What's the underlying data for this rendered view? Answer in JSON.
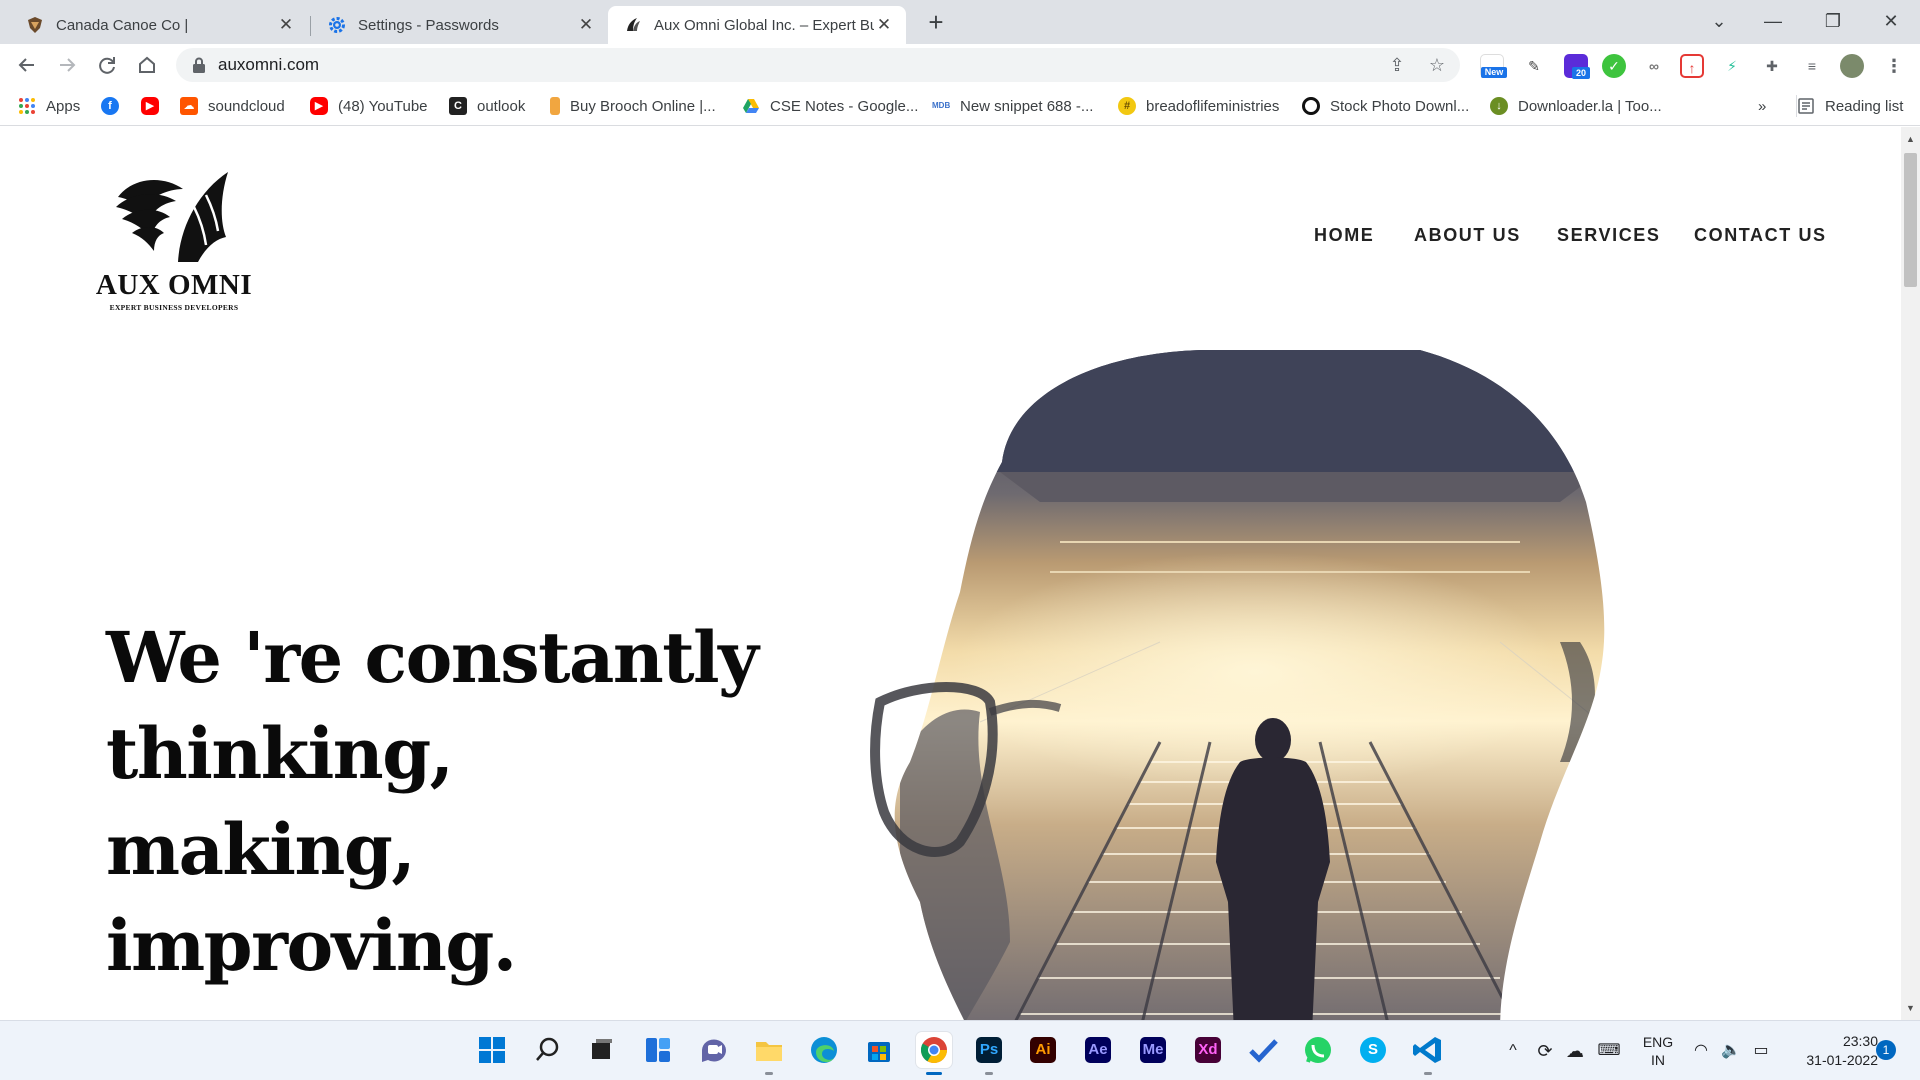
{
  "browser": {
    "tabs": [
      {
        "title": "Canada Canoe Co |",
        "favicon": "canoe-favicon",
        "active": false
      },
      {
        "title": "Settings - Passwords",
        "favicon": "gear-icon",
        "active": false
      },
      {
        "title": "Aux Omni Global Inc. – Expert Bu",
        "favicon": "aux-omni-favicon",
        "active": true
      }
    ],
    "close_glyph": "✕",
    "new_tab_glyph": "+",
    "window_controls": {
      "menu": "⌄",
      "minimize": "—",
      "restore": "❐",
      "close": "✕"
    },
    "url": "auxomni.com",
    "extension_badges": {
      "new": "New",
      "count": "20"
    }
  },
  "bookmarks": {
    "apps": "Apps",
    "items": [
      {
        "label": "",
        "icon": "facebook-icon",
        "color": "#1877f2"
      },
      {
        "label": "",
        "icon": "youtube-icon",
        "color": "#ff0000"
      },
      {
        "label": "soundcloud",
        "icon": "soundcloud-icon",
        "color": "#ff5500"
      },
      {
        "label": "(48) YouTube",
        "icon": "youtube-icon",
        "color": "#ff0000"
      },
      {
        "label": "outlook",
        "icon": "outlook-icon",
        "color": "#222"
      },
      {
        "label": "Buy Brooch Online |...",
        "icon": "brooch-icon",
        "color": "#f1a640"
      },
      {
        "label": "CSE Notes - Google...",
        "icon": "google-drive-icon",
        "color": "#1fa463"
      },
      {
        "label": "New snippet 688 -...",
        "icon": "mdb-icon",
        "color": "#3b71ca"
      },
      {
        "label": "breadoflifeministries",
        "icon": "hash-icon",
        "color": "#f2c811"
      },
      {
        "label": "Stock Photo Downl...",
        "icon": "stock-photo-icon",
        "color": "#111"
      },
      {
        "label": "Downloader.la | Too...",
        "icon": "downloader-icon",
        "color": "#6b8e23"
      }
    ],
    "overflow": "»",
    "reading_list": "Reading list"
  },
  "site": {
    "logo": {
      "brand": "AUX OMNI",
      "tagline": "EXPERT BUSINESS DEVELOPERS"
    },
    "nav": [
      "HOME",
      "ABOUT US",
      "SERVICES",
      "CONTACT US"
    ],
    "hero_lines": [
      "We 're constantly",
      "thinking,",
      "making,",
      "improving."
    ]
  },
  "taskbar": {
    "apps": [
      {
        "name": "windows-start",
        "label": "",
        "color": "#0078d4"
      },
      {
        "name": "search",
        "label": "",
        "color": "#222"
      },
      {
        "name": "task-view",
        "label": "",
        "color": "#222"
      },
      {
        "name": "widgets",
        "label": "",
        "color": "#1e6fd9"
      },
      {
        "name": "teams-chat",
        "label": "",
        "color": "#6264a7"
      },
      {
        "name": "file-explorer",
        "label": "",
        "color": "#f4c542"
      },
      {
        "name": "edge",
        "label": "",
        "color": "#0c8fd6"
      },
      {
        "name": "microsoft-store",
        "label": "",
        "color": "#0067c0"
      },
      {
        "name": "chrome",
        "label": "",
        "color": "#db4437"
      },
      {
        "name": "photoshop",
        "label": "Ps",
        "color": "#001e36"
      },
      {
        "name": "illustrator",
        "label": "Ai",
        "color": "#330000"
      },
      {
        "name": "after-effects",
        "label": "Ae",
        "color": "#00005b"
      },
      {
        "name": "media-encoder",
        "label": "Me",
        "color": "#00005b"
      },
      {
        "name": "adobe-xd",
        "label": "Xd",
        "color": "#470137"
      },
      {
        "name": "todo",
        "label": "",
        "color": "#2564cf"
      },
      {
        "name": "whatsapp",
        "label": "",
        "color": "#25d366"
      },
      {
        "name": "skype",
        "label": "S",
        "color": "#00aff0"
      },
      {
        "name": "vscode",
        "label": "",
        "color": "#007acc"
      }
    ],
    "tray": {
      "lang_top": "ENG",
      "lang_bottom": "IN",
      "time": "23:30",
      "date": "31-01-2022",
      "notifications": "1"
    }
  }
}
